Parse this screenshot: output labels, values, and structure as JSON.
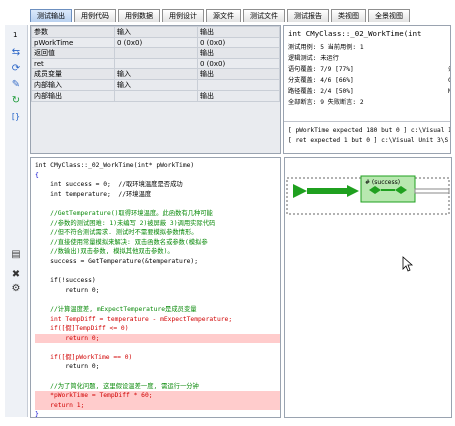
{
  "tabs": [
    {
      "label": "测试输出",
      "active": true
    },
    {
      "label": "用例代码",
      "active": false
    },
    {
      "label": "用例数据",
      "active": false
    },
    {
      "label": "用例设计",
      "active": false
    },
    {
      "label": "源文件",
      "active": false
    },
    {
      "label": "测试文件",
      "active": false
    },
    {
      "label": "测试报告",
      "active": false
    },
    {
      "label": "类视图",
      "active": false
    },
    {
      "label": "全景视图",
      "active": false
    }
  ],
  "left_strip": {
    "top_value": "1",
    "icons": [
      "arrows-icon",
      "gear-arrow-icon",
      "edit-icon",
      "refresh-icon",
      "code-braces-icon",
      "list-icon",
      "close-icon",
      "settings-icon"
    ]
  },
  "var_table": {
    "rows": [
      {
        "c1": "参数",
        "c2": "输入",
        "c3": "输出",
        "style": "hdr"
      },
      {
        "c1": "pWorkTime",
        "c2": "0 (0x0)",
        "c3": "0 (0x0)",
        "style": ""
      },
      {
        "c1": "返回值",
        "c2": "",
        "c3": "输出",
        "style": "hdr"
      },
      {
        "c1": "ret",
        "c2": "",
        "c3": "0 (0x0)",
        "style": ""
      },
      {
        "c1": "成员变量",
        "c2": "输入",
        "c3": "输出",
        "style": "hdr"
      },
      {
        "c1": "内部输入",
        "c2": "输入",
        "c3": "",
        "style": "grey"
      },
      {
        "c1": "内部输出",
        "c2": "",
        "c3": "输出",
        "style": "grey"
      }
    ]
  },
  "info": {
    "title": "int CMyClass::_02_WorkTime(int",
    "line1": "测试用例: 5  当前用例: 1",
    "line2": "逻辑测试: 未运行",
    "cov": [
      [
        "语句覆盖: 7/9 [77%]",
        "",
        "条件覆盖: 4/6 [",
        ""
      ],
      [
        "分支覆盖: 4/6 [66%]",
        "",
        "C/DC: 8/12 [6",
        ""
      ],
      [
        "路径覆盖: 2/4 [50%]",
        "",
        "MC/DC: 9/15 [6",
        ""
      ]
    ],
    "asserts": "全部断言: 9  失败断言: 2",
    "out1": "[ pWorkTime expected 180 but 0 ] c:\\Visual I",
    "out2": "[ ret expected 1 but 0 ] c:\\Visual Unit 3\\S"
  },
  "code_lines": [
    {
      "t": "int CMyClass::_02_WorkTime(int* pWorkTime)",
      "c": ""
    },
    {
      "t": "{",
      "c": "kw"
    },
    {
      "t": "    int success = 0;  //取环境温度是否成功",
      "c": ""
    },
    {
      "t": "    int temperature;  //环境温度",
      "c": ""
    },
    {
      "t": "",
      "c": ""
    },
    {
      "t": "    //GetTemperature()取得环境温度。此函数有几种可能",
      "c": "cm"
    },
    {
      "t": "    //参数的测试困难: 1)未编写 2)被屏蔽 3)调用实际代码",
      "c": "cm"
    },
    {
      "t": "    //但不符合测试需求. 测试时不需要模拟参数情形。",
      "c": "cm"
    },
    {
      "t": "    //直接使用常量模拟来解决: 双击函数名或参数(模拟参",
      "c": "cm"
    },
    {
      "t": "    //数输出)双击参数, 模拟其他双击参数)。",
      "c": "cm"
    },
    {
      "t": "    success = GetTemperature(&temperature);",
      "c": ""
    },
    {
      "t": "",
      "c": ""
    },
    {
      "t": "    if(!success)",
      "c": ""
    },
    {
      "t": "        return 0;",
      "c": ""
    },
    {
      "t": "",
      "c": ""
    },
    {
      "t": "    //计算温度差, mExpectTemperature是成员变量",
      "c": "cm"
    },
    {
      "t": "    int TempDiff = temperature - mExpectTemperature;",
      "c": "red"
    },
    {
      "t": "    if([假]TempDiff <= 0)",
      "c": "red"
    },
    {
      "t": "        return 0;",
      "c": "red hl"
    },
    {
      "t": "",
      "c": ""
    },
    {
      "t": "    if([假]pWorkTime == 0)",
      "c": "red"
    },
    {
      "t": "        return 0;",
      "c": ""
    },
    {
      "t": "",
      "c": ""
    },
    {
      "t": "    //为了简化问题, 这里假设温差一度, 需运行一分钟",
      "c": "cm"
    },
    {
      "t": "    *pWorkTime = TempDiff * 60;",
      "c": "red hl"
    },
    {
      "t": "    return 1;",
      "c": "red hl"
    },
    {
      "t": "}",
      "c": "kw"
    }
  ],
  "diagram": {
    "node_label": "# (success)"
  },
  "colors": {
    "tab_active": "#b9d1f0",
    "code_green": "#0a8a0a",
    "code_blue": "#0000d0",
    "error_red": "#d00000",
    "path_green": "#1fa01f"
  }
}
